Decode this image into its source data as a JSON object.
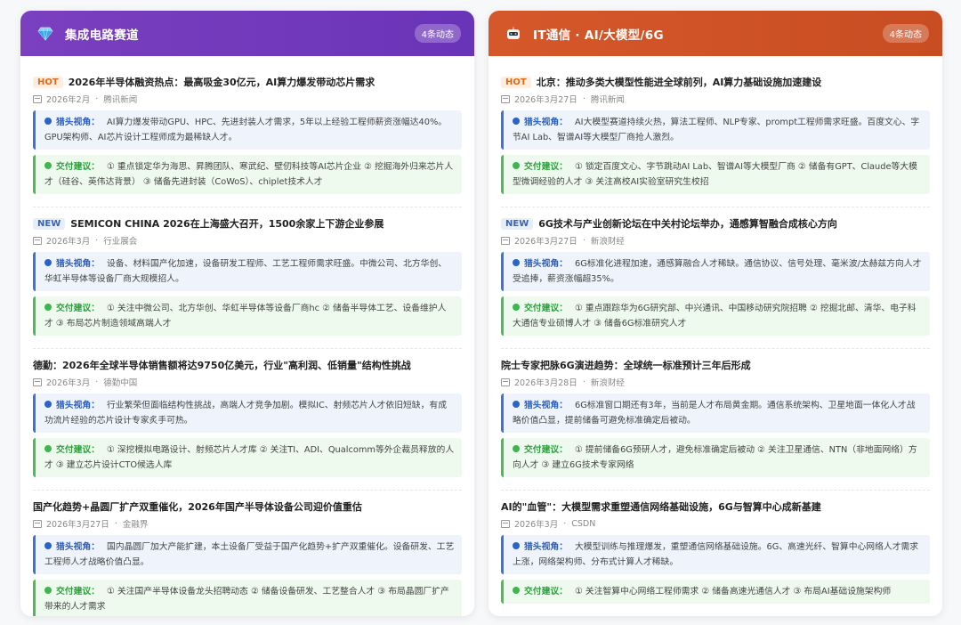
{
  "cards": [
    {
      "title": "集成电路赛道",
      "icon": "gem-icon",
      "badge": "4条动态",
      "items": [
        {
          "tag": "HOT",
          "title": "2026年半导体融资热点：最高吸金30亿元，AI算力爆发带动芯片需求",
          "date": "2026年2月",
          "source": "腾讯新闻",
          "insight": "AI算力爆发带动GPU、HPC、先进封装人才需求，5年以上经验工程师薪资涨幅达40%。GPU架构师、AI芯片设计工程师成为最稀缺人才。",
          "advice": "① 重点锁定华为海思、昇腾团队、寒武纪、壁仞科技等AI芯片企业 ② 挖掘海外归来芯片人才（硅谷、英伟达背景） ③ 储备先进封装（CoWoS）、chiplet技术人才"
        },
        {
          "tag": "NEW",
          "title": "SEMICON CHINA 2026在上海盛大召开，1500余家上下游企业参展",
          "date": "2026年3月",
          "source": "行业展会",
          "insight": "设备、材料国产化加速，设备研发工程师、工艺工程师需求旺盛。中微公司、北方华创、华虹半导体等设备厂商大规模招人。",
          "advice": "① 关注中微公司、北方华创、华虹半导体等设备厂商hc ② 储备半导体工艺、设备维护人才 ③ 布局芯片制造领域高端人才"
        },
        {
          "tag": "",
          "title": "德勤：2026年全球半导体销售额将达9750亿美元，行业\"高利润、低销量\"结构性挑战",
          "date": "2026年3月",
          "source": "德勤中国",
          "insight": "行业繁荣但面临结构性挑战，高端人才竞争加剧。模拟IC、射频芯片人才依旧短缺，有成功流片经验的芯片设计专家炙手可热。",
          "advice": "① 深挖模拟电路设计、射频芯片人才库 ② 关注TI、ADI、Qualcomm等外企裁员释放的人才 ③ 建立芯片设计CTO候选人库"
        },
        {
          "tag": "",
          "title": "国产化趋势+晶圆厂扩产双重催化，2026年国产半导体设备公司迎价值重估",
          "date": "2026年3月27日",
          "source": "金融界",
          "insight": "国内晶圆厂加大产能扩建，本土设备厂受益于国产化趋势+扩产双重催化。设备研发、工艺工程师人才战略价值凸显。",
          "advice": "① 关注国产半导体设备龙头招聘动态 ② 储备设备研发、工艺整合人才 ③ 布局晶圆厂扩产带来的人才需求"
        }
      ]
    },
    {
      "title": "IT通信 · AI/大模型/6G",
      "icon": "robot-icon",
      "badge": "4条动态",
      "items": [
        {
          "tag": "HOT",
          "title": "北京：推动多类大模型性能进全球前列，AI算力基础设施加速建设",
          "date": "2026年3月27日",
          "source": "腾讯新闻",
          "insight": "AI大模型赛道持续火热，算法工程师、NLP专家、prompt工程师需求旺盛。百度文心、字节AI Lab、智谱AI等大模型厂商抢人激烈。",
          "advice": "① 锁定百度文心、字节跳动AI Lab、智谱AI等大模型厂商 ② 储备有GPT、Claude等大模型微调经验的人才 ③ 关注高校AI实验室研究生校招"
        },
        {
          "tag": "NEW",
          "title": "6G技术与产业创新论坛在中关村论坛举办，通感算智融合成核心方向",
          "date": "2026年3月27日",
          "source": "新浪财经",
          "insight": "6G标准化进程加速，通感算融合人才稀缺。通信协议、信号处理、毫米波/太赫兹方向人才受追捧，薪资涨幅超35%。",
          "advice": "① 重点跟踪华为6G研究部、中兴通讯、中国移动研究院招聘 ② 挖掘北邮、清华、电子科大通信专业硕博人才 ③ 储备6G标准研究人才"
        },
        {
          "tag": "",
          "title": "院士专家把脉6G演进趋势：全球统一标准预计三年后形成",
          "date": "2026年3月28日",
          "source": "新浪财经",
          "insight": "6G标准窗口期还有3年，当前是人才布局黄金期。通信系统架构、卫星地面一体化人才战略价值凸显，提前储备可避免标准确定后被动。",
          "advice": "① 提前储备6G预研人才，避免标准确定后被动 ② 关注卫星通信、NTN（非地面网络）方向人才 ③ 建立6G技术专家网络"
        },
        {
          "tag": "",
          "title": "AI的\"血管\"：大模型需求重塑通信网络基础设施，6G与智算中心成新基建",
          "date": "2026年3月",
          "source": "CSDN",
          "insight": "大模型训练与推理爆发，重塑通信网络基础设施。6G、高速光纤、智算中心网络人才需求上涨，网络架构师、分布式计算人才稀缺。",
          "advice": "① 关注智算中心网络工程师需求 ② 储备高速光通信人才 ③ 布局AI基础设施架构师"
        }
      ]
    }
  ],
  "labels": {
    "insight": "猎头视角：",
    "advice": "交付建议：",
    "sep": "·"
  },
  "colors": {
    "left_header": "#7b3fc0",
    "right_header": "#d4582a",
    "insight_accent": "#3d73d6",
    "advice_accent": "#4cbb58",
    "hot_tag": "#e06a1c",
    "new_tag": "#3a63b8"
  }
}
